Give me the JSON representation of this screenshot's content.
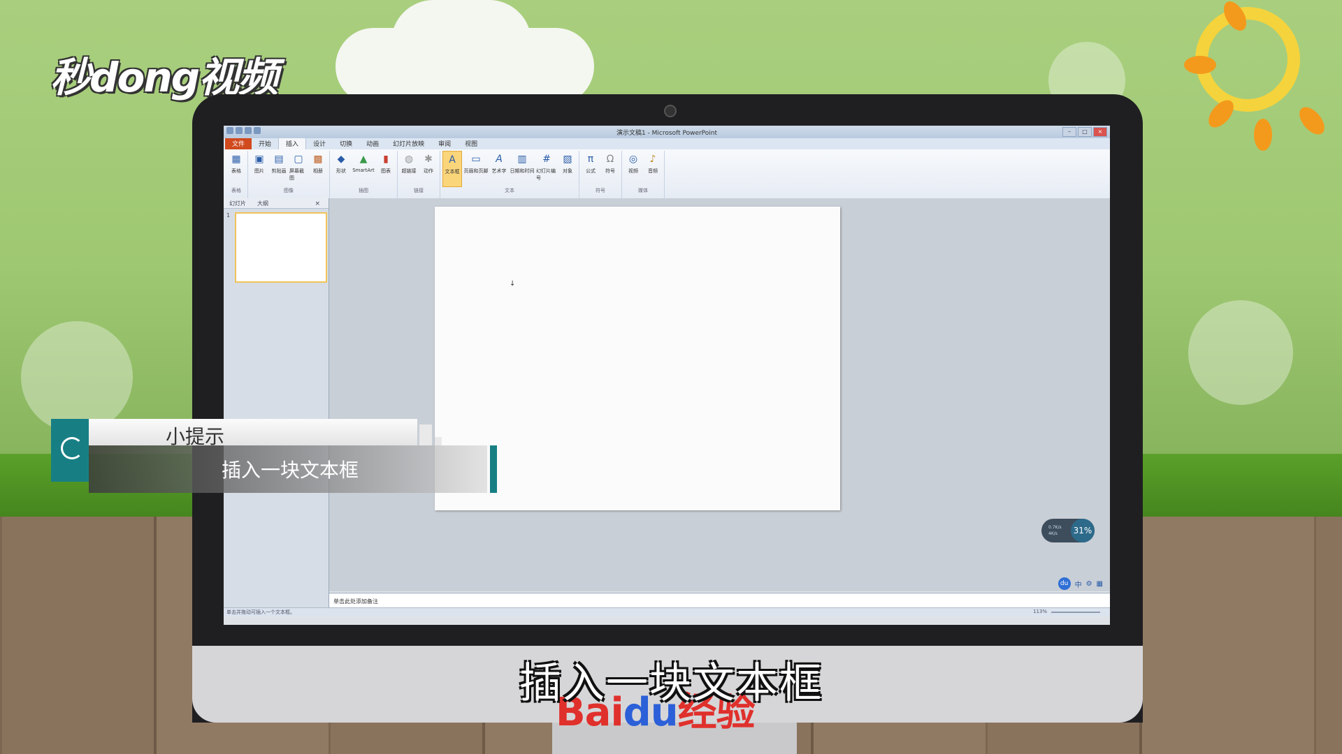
{
  "brand": {
    "logo_text": "秒dong视频",
    "watermark_bai": "Bai",
    "watermark_du": "du",
    "watermark_suffix": "经验"
  },
  "tip": {
    "heading": "小提示",
    "body": "插入一块文本框"
  },
  "subtitle": "插入一块文本框",
  "app": {
    "window_title": "演示文稿1 - Microsoft PowerPoint",
    "tabs": [
      "文件",
      "开始",
      "插入",
      "设计",
      "切换",
      "动画",
      "幻灯片放映",
      "审阅",
      "视图"
    ],
    "active_tab": "插入",
    "ribbon_groups": [
      {
        "label": "表格",
        "buttons": [
          {
            "label": "表格",
            "icon": "table-icon"
          }
        ]
      },
      {
        "label": "图像",
        "buttons": [
          {
            "label": "图片",
            "icon": "picture-icon"
          },
          {
            "label": "剪贴画",
            "icon": "clipart-icon"
          },
          {
            "label": "屏幕截图",
            "icon": "screenshot-icon"
          },
          {
            "label": "相册",
            "icon": "album-icon"
          }
        ]
      },
      {
        "label": "插图",
        "buttons": [
          {
            "label": "形状",
            "icon": "shapes-icon"
          },
          {
            "label": "SmartArt",
            "icon": "smartart-icon"
          },
          {
            "label": "图表",
            "icon": "chart-icon"
          }
        ]
      },
      {
        "label": "链接",
        "buttons": [
          {
            "label": "超链接",
            "icon": "hyperlink-icon"
          },
          {
            "label": "动作",
            "icon": "action-icon"
          }
        ]
      },
      {
        "label": "文本",
        "buttons": [
          {
            "label": "文本框",
            "icon": "textbox-icon"
          },
          {
            "label": "页眉和页脚",
            "icon": "header-footer-icon"
          },
          {
            "label": "艺术字",
            "icon": "wordart-icon"
          },
          {
            "label": "日期和时间",
            "icon": "datetime-icon"
          },
          {
            "label": "幻灯片编号",
            "icon": "slide-number-icon"
          },
          {
            "label": "对象",
            "icon": "object-icon"
          }
        ]
      },
      {
        "label": "符号",
        "buttons": [
          {
            "label": "公式",
            "icon": "pi-icon"
          },
          {
            "label": "符号",
            "icon": "omega-icon"
          }
        ]
      },
      {
        "label": "媒体",
        "buttons": [
          {
            "label": "视频",
            "icon": "video-icon"
          },
          {
            "label": "音频",
            "icon": "audio-icon"
          }
        ]
      }
    ],
    "selected_button": "文本框",
    "panel_tabs": [
      "幻灯片",
      "大纲"
    ],
    "slide_number": "1",
    "notes_placeholder": "单击此处添加备注",
    "status_text": "单击并拖动可插入一个文本框。",
    "zoom": "113%",
    "net_speed": {
      "up": "0.7K/s",
      "down": "4K/s",
      "percent": "31%"
    },
    "ime_text": "中"
  }
}
